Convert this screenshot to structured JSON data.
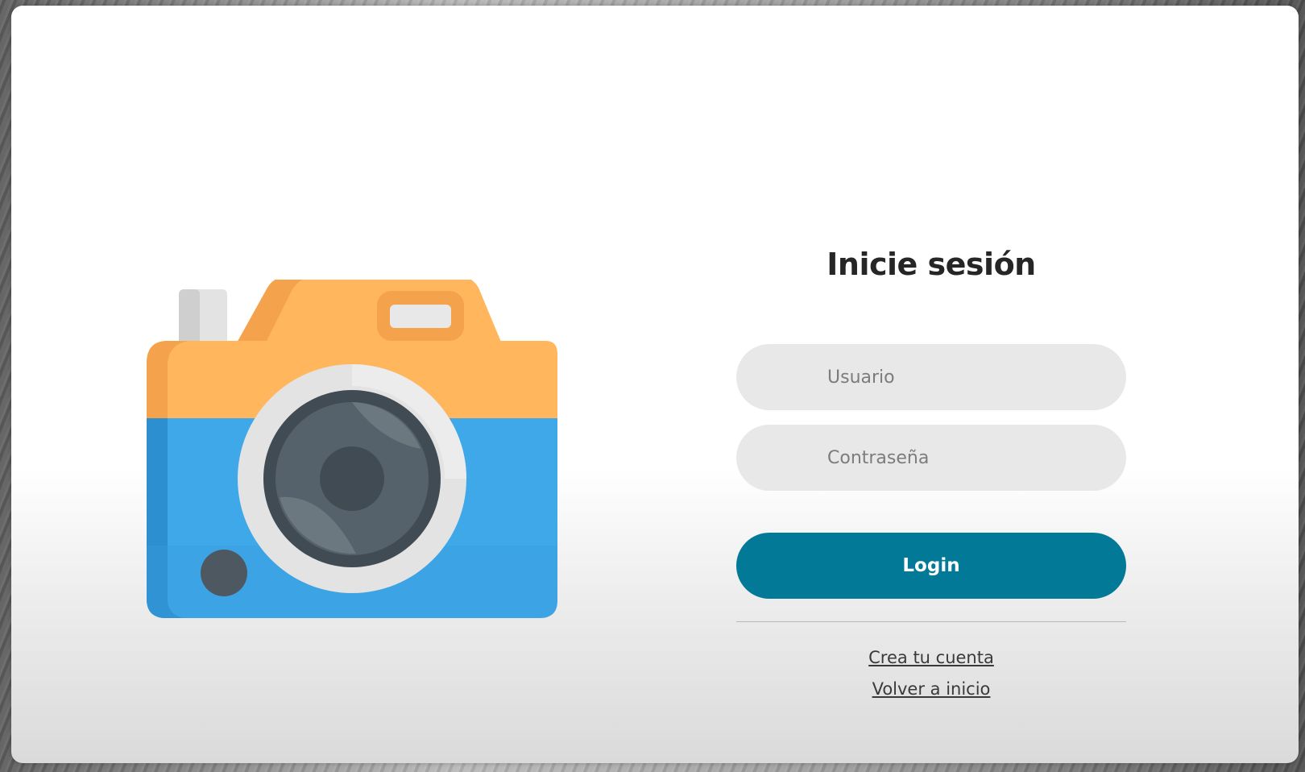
{
  "login": {
    "title": "Inicie sesión",
    "username_placeholder": "Usuario",
    "password_placeholder": "Contraseña",
    "submit_label": "Login",
    "create_account_link": "Crea tu cuenta",
    "back_home_link": "Volver a inicio"
  },
  "illustration": {
    "icon": "camera-icon",
    "colors": {
      "body_top": "#ffb65c",
      "body_bottom": "#3ea8e8",
      "lens": "#4e5861",
      "ring": "#e8e8e8"
    }
  },
  "colors": {
    "primary": "#027996",
    "input_bg": "#e8e8e8",
    "title": "#262626"
  }
}
